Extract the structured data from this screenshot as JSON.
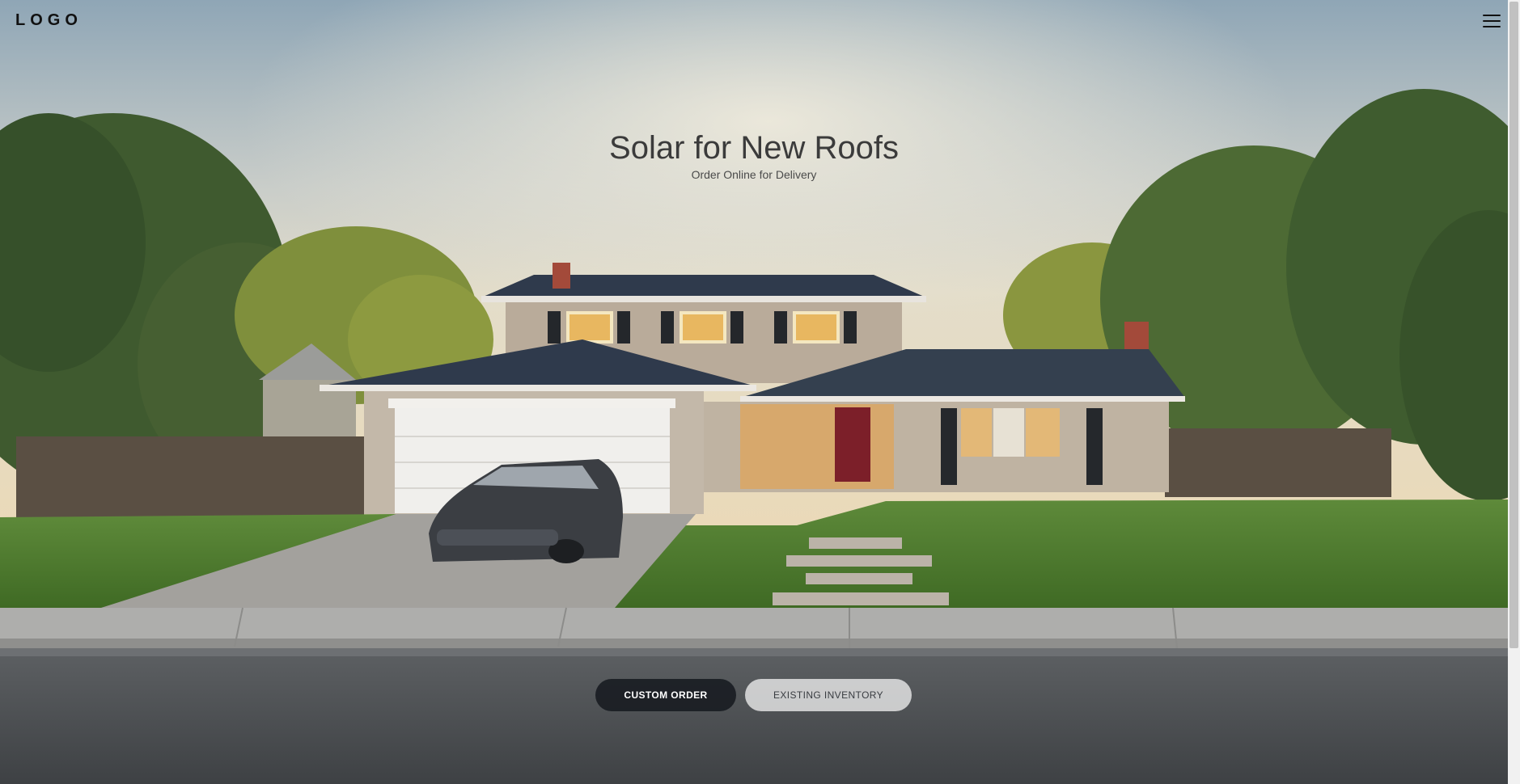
{
  "header": {
    "logo_text": "LOGO",
    "menu_icon": "hamburger-menu-icon"
  },
  "hero": {
    "title": "Solar for New Roofs",
    "subtitle": "Order Online for Delivery"
  },
  "actions": {
    "primary_label": "CUSTOM ORDER",
    "secondary_label": "EXISTING INVENTORY"
  },
  "colors": {
    "primary_button_bg": "#171a20",
    "secondary_button_bg": "#f4f4f4",
    "title_text": "#3b3b3b"
  }
}
